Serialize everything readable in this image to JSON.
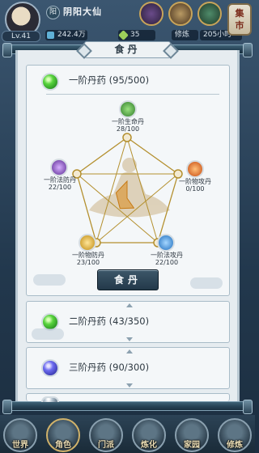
{
  "player": {
    "name": "阴阳大仙",
    "level": "Lv.41",
    "sect_badge": "阳",
    "stat_spirit": "242.4万",
    "stat_gems": "35",
    "cultivation_label": "修炼",
    "cultivation_time": "205小时"
  },
  "top_icons": [
    "character-icon",
    "book-icon",
    "pet-icon"
  ],
  "market": {
    "label_top": "集",
    "label_bottom": "市"
  },
  "panel": {
    "title": "食丹"
  },
  "tier1": {
    "title": "一阶丹药 (95/500)",
    "nodes": [
      {
        "name": "一阶生命丹",
        "progress": "28/100",
        "icon": "life-pill-icon",
        "color": "#3f9b3a"
      },
      {
        "name": "一阶物攻丹",
        "progress": "0/100",
        "icon": "physical-attack-pill-icon",
        "color": "#e0641c"
      },
      {
        "name": "一阶法攻丹",
        "progress": "22/100",
        "icon": "magic-attack-pill-icon",
        "color": "#2c7fd1"
      },
      {
        "name": "一阶物防丹",
        "progress": "23/100",
        "icon": "physical-defense-pill-icon",
        "color": "#d9a61f"
      },
      {
        "name": "一阶法防丹",
        "progress": "22/100",
        "icon": "magic-defense-pill-icon",
        "color": "#7c3fb3"
      }
    ],
    "eat_button": "食丹"
  },
  "tier2": {
    "title": "二阶丹药 (43/350)"
  },
  "tier3": {
    "title": "三阶丹药 (90/300)"
  },
  "nav": [
    {
      "label": "世界",
      "icon": "world-icon"
    },
    {
      "label": "角色",
      "icon": "character-icon"
    },
    {
      "label": "门派",
      "icon": "sect-icon"
    },
    {
      "label": "炼化",
      "icon": "refine-icon"
    },
    {
      "label": "家园",
      "icon": "home-icon"
    },
    {
      "label": "修炼",
      "icon": "cultivate-icon"
    }
  ]
}
